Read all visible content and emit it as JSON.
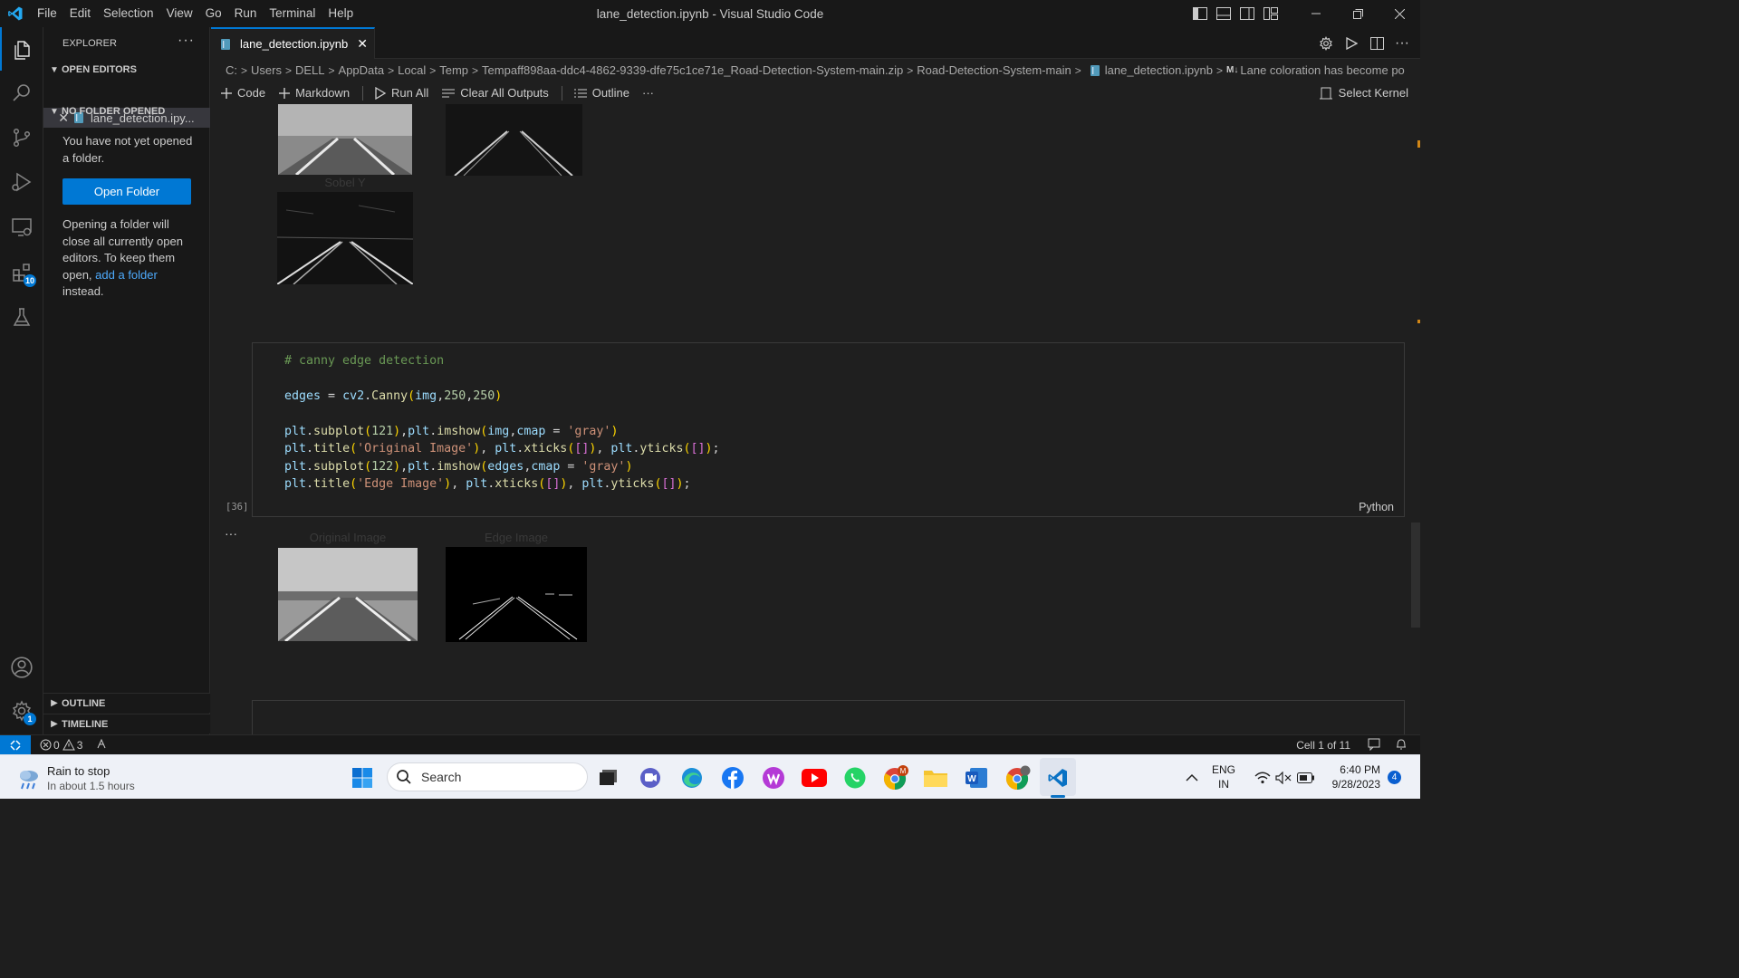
{
  "window": {
    "title": "lane_detection.ipynb - Visual Studio Code",
    "menu": [
      "File",
      "Edit",
      "Selection",
      "View",
      "Go",
      "Run",
      "Terminal",
      "Help"
    ]
  },
  "activity_bar": {
    "extensions_badge": "10",
    "settings_badge": "1"
  },
  "sidebar": {
    "header": "EXPLORER",
    "open_editors_label": "OPEN EDITORS",
    "open_editor_file": "lane_detection.ipy...",
    "no_folder_label": "NO FOLDER OPENED",
    "no_folder_msg": "You have not yet opened a folder.",
    "open_folder_button": "Open Folder",
    "info_text_1": "Opening a folder will close all currently open editors. To keep them open,",
    "info_link": "add a folder",
    "info_text_2": "instead.",
    "outline_label": "OUTLINE",
    "timeline_label": "TIMELINE"
  },
  "editor": {
    "tab_label": "lane_detection.ipynb",
    "breadcrumb": [
      "C:",
      "Users",
      "DELL",
      "AppData",
      "Local",
      "Temp",
      "Tempaff898aa-ddc4-4862-9339-dfe75c1ce71e_Road-Detection-System-main.zip",
      "Road-Detection-System-main",
      "lane_detection.ipynb",
      "Lane coloration has become po"
    ],
    "breadcrumb_md_prefix": "M↓",
    "toolbar": {
      "code": "Code",
      "markdown": "Markdown",
      "run_all": "Run All",
      "clear_outputs": "Clear All Outputs",
      "outline": "Outline",
      "more": "···",
      "kernel": "Select Kernel"
    }
  },
  "notebook": {
    "sobel_y_caption": "Sobel Y",
    "code_cell": {
      "comment": "# canny edge detection",
      "exec_count": "[36]",
      "language": "Python"
    },
    "output_more": "···",
    "captions": {
      "original": "Original Image",
      "edge": "Edge Image"
    }
  },
  "statusbar": {
    "errors": "0",
    "warnings": "3",
    "cell_info": "Cell 1 of 11"
  },
  "taskbar": {
    "weather_title": "Rain to stop",
    "weather_sub": "In about 1.5 hours",
    "search_placeholder": "Search",
    "lang_1": "ENG",
    "lang_2": "IN",
    "time": "6:40 PM",
    "date": "9/28/2023",
    "notif_count": "4"
  },
  "colors": {
    "accent": "#0078d4",
    "background": "#1f1f1f",
    "sidebar": "#181818"
  }
}
